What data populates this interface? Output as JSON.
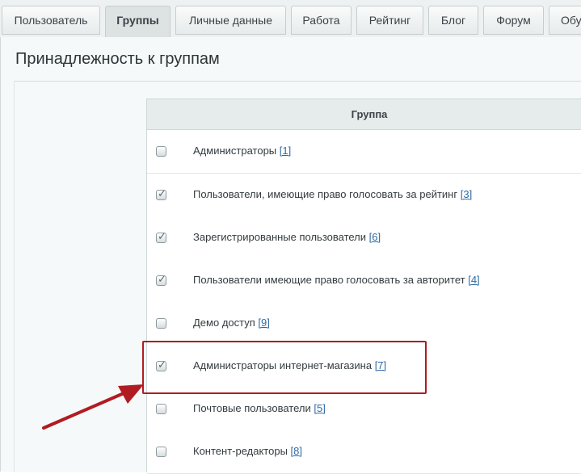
{
  "tabs": [
    {
      "label": "Пользователь",
      "active": false
    },
    {
      "label": "Группы",
      "active": true
    },
    {
      "label": "Личные данные",
      "active": false
    },
    {
      "label": "Работа",
      "active": false
    },
    {
      "label": "Рейтинг",
      "active": false
    },
    {
      "label": "Блог",
      "active": false
    },
    {
      "label": "Форум",
      "active": false
    },
    {
      "label": "Обу",
      "active": false
    }
  ],
  "section": {
    "title": "Принадлежность к группам"
  },
  "table": {
    "header": "Группа",
    "rows": [
      {
        "name": "Администраторы",
        "id": "[1]",
        "checked": false
      },
      {
        "name": "Пользователи, имеющие право голосовать за рейтинг",
        "id": "[3]",
        "checked": true
      },
      {
        "name": "Зарегистрированные пользователи",
        "id": "[6]",
        "checked": true
      },
      {
        "name": "Пользователи имеющие право голосовать за авторитет",
        "id": "[4]",
        "checked": true
      },
      {
        "name": "Демо доступ",
        "id": "[9]",
        "checked": false
      },
      {
        "name": "Администраторы интернет-магазина",
        "id": "[7]",
        "checked": true
      },
      {
        "name": "Почтовые пользователи",
        "id": "[5]",
        "checked": false
      },
      {
        "name": "Контент-редакторы",
        "id": "[8]",
        "checked": false
      }
    ]
  },
  "annotation": {
    "highlight_color": "#b01c22",
    "arrow_color": "#b01c22"
  }
}
